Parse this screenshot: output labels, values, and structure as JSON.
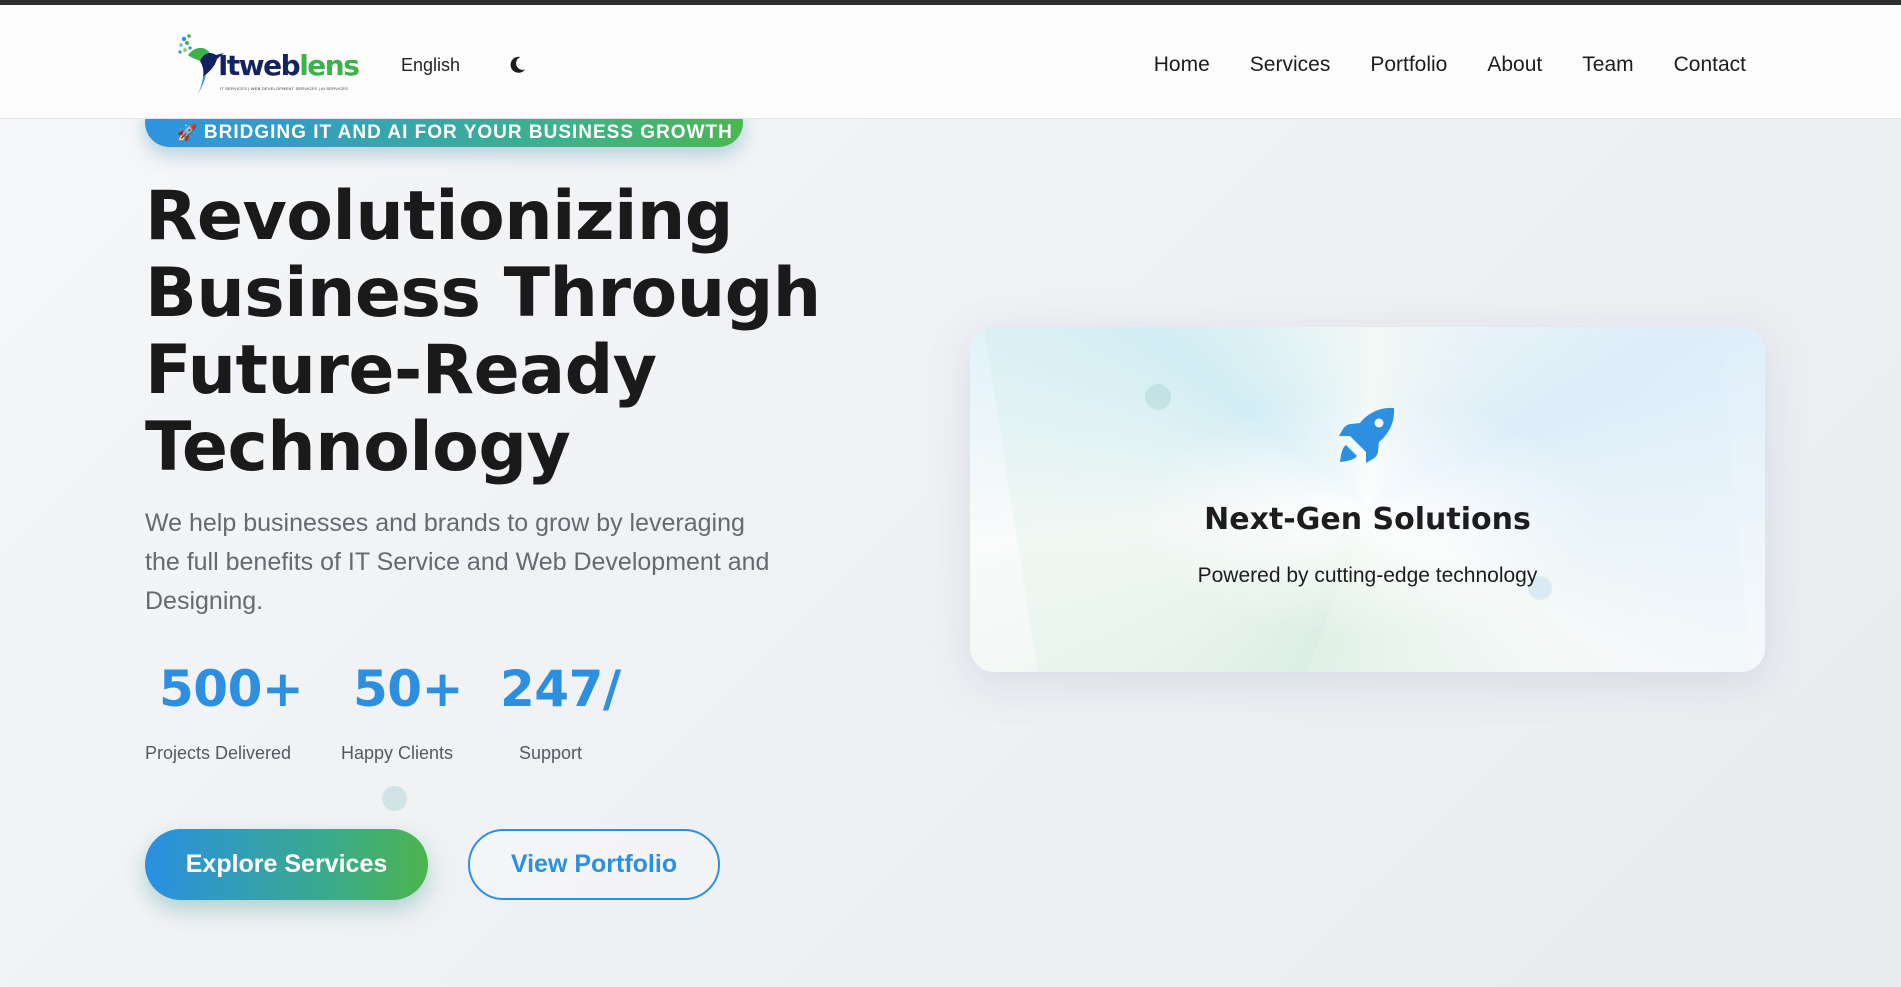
{
  "header": {
    "logo": {
      "word_a": "Itweb",
      "word_b": "lens",
      "tagline": "IT SERVICES | WEB DEVELOPMENT SERVICES | AI SERVICES"
    },
    "language": "English",
    "theme_icon": "moon-icon",
    "nav": [
      "Home",
      "Services",
      "Portfolio",
      "About",
      "Team",
      "Contact"
    ]
  },
  "hero": {
    "badge": {
      "icon": "rocket-emoji",
      "text": "BRIDGING IT AND AI FOR YOUR BUSINESS GROWTH"
    },
    "title_lines": [
      "Revolutionizing",
      "Business Through",
      "Future-Ready",
      "Technology"
    ],
    "description": "We help businesses and brands to grow by leveraging the full benefits of IT Service and Web Development and Designing.",
    "stats": [
      {
        "value": "500+",
        "label": "Projects Delivered"
      },
      {
        "value": "50+",
        "label": "Happy Clients"
      },
      {
        "value": "247/",
        "label": "Support"
      }
    ],
    "primary_button": "Explore Services",
    "secondary_button": "View Portfolio"
  },
  "card": {
    "icon": "rocket-icon",
    "title": "Next-Gen Solutions",
    "subtitle": "Powered by cutting-edge technology"
  },
  "colors": {
    "accent_blue": "#2d8fe0",
    "accent_green": "#4cb653",
    "logo_navy": "#13235f",
    "topline": "#2f2f2f"
  }
}
